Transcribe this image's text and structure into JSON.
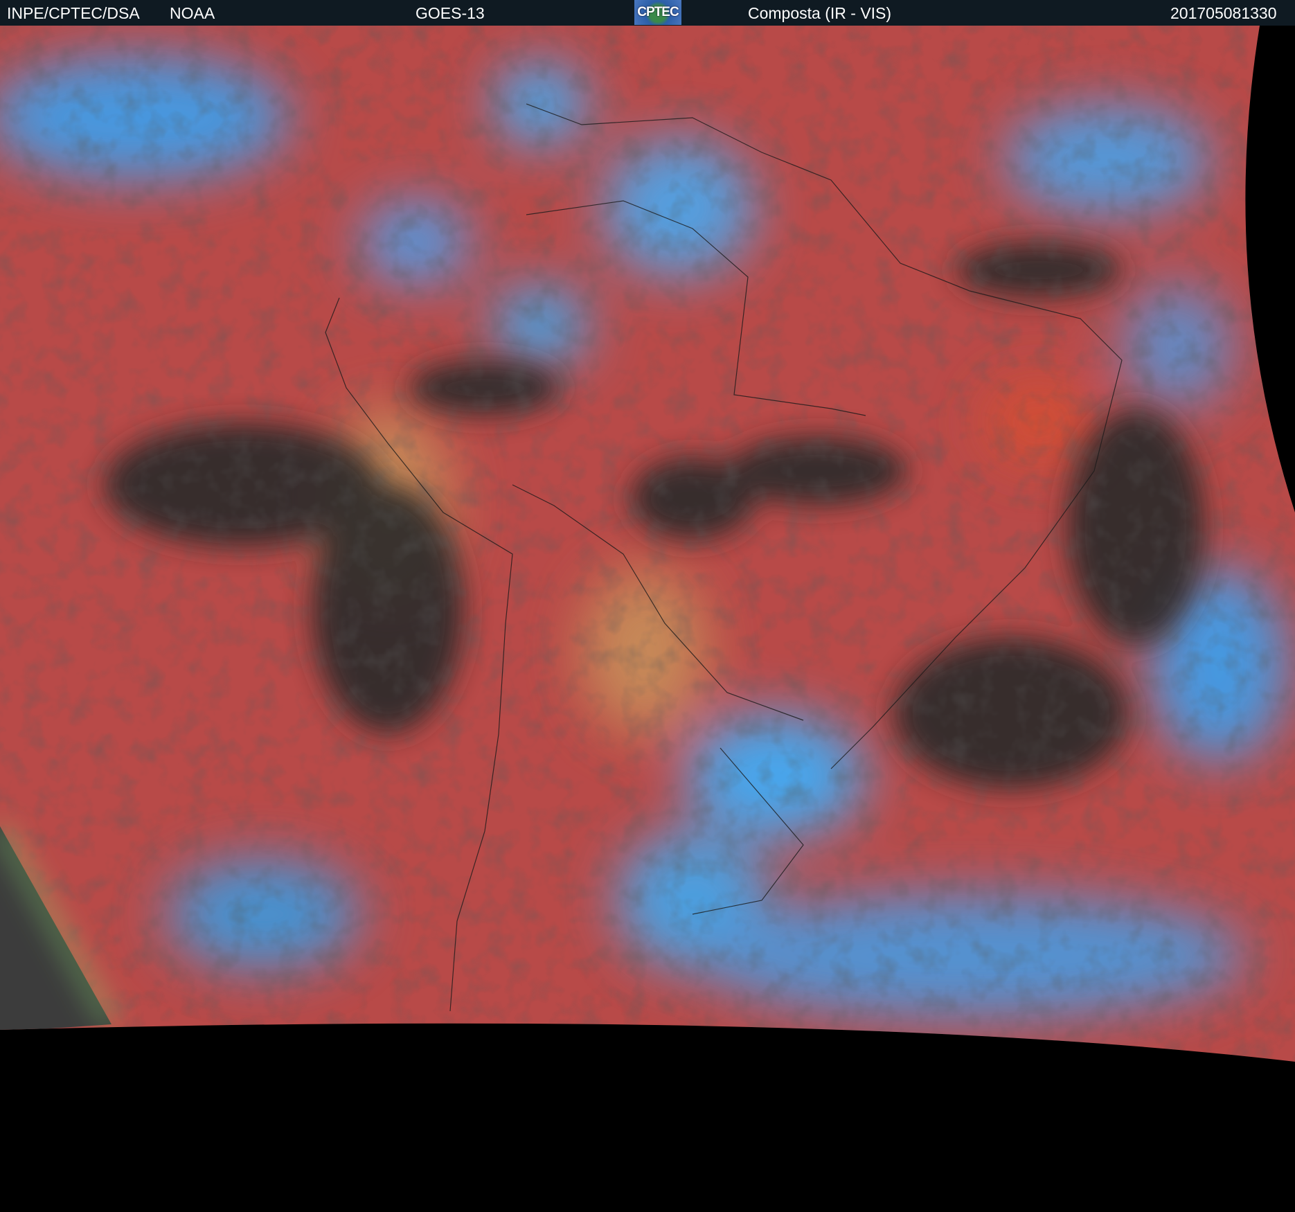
{
  "header": {
    "agency": "INPE/CPTEC/DSA",
    "partner": "NOAA",
    "satellite": "GOES-13",
    "logo_text": "CPTEC",
    "product": "Composta (IR - VIS)",
    "timestamp": "201705081330"
  },
  "colors": {
    "header_bg": "#0f1a22",
    "clear_land": "#b84a48",
    "high_cloud": "#3aa8f0",
    "low_cloud": "#2a2a2a"
  }
}
